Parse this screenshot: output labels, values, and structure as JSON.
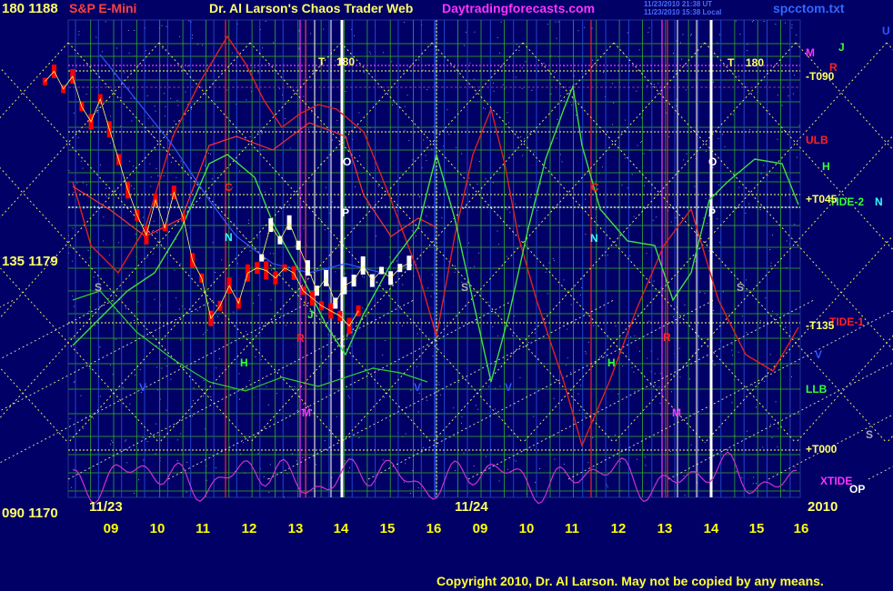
{
  "header": {
    "left_levels": "180  1188",
    "instrument": "S&P E-Mini",
    "title": "Dr. Al Larson's Chaos Trader Web",
    "site": "Daytradingforecasts.com",
    "stamp_line1": "11/23/2010 21:38 UT",
    "stamp_line2": "11/23/2010 15:38 Local",
    "filename": "spcctom.txt"
  },
  "y_labels": {
    "top": "180  1188",
    "mid": "135  1179",
    "bottom": "090  1170"
  },
  "date_labels": {
    "day1": "11/23",
    "day2": "11/24",
    "year": "2010"
  },
  "x_ticks": [
    "09",
    "10",
    "11",
    "12",
    "13",
    "14",
    "15",
    "16",
    "09",
    "10",
    "11",
    "12",
    "13",
    "14",
    "15",
    "16"
  ],
  "right_labels": {
    "m": "M",
    "j": "J",
    "u": "U",
    "r": "R",
    "t090": "-T090",
    "ulb": "ULB",
    "h": "H",
    "t045": "+T045",
    "tide2": "TIDE-2",
    "n": "N",
    "t135": "-T135",
    "tide1": "TIDE-1",
    "v": "V",
    "llb": "LLB",
    "s": "S",
    "t000": "+T000",
    "xtide": "XTIDE",
    "op": "OP"
  },
  "chart_markers": {
    "t180": "T",
    "n180": "180",
    "o": "O",
    "p": "P",
    "c": "C",
    "n": "N",
    "s": "S",
    "h": "H",
    "r": "R",
    "m": "M",
    "v": "V",
    "j": "J"
  },
  "copyright": "Copyright 2010, Dr. Al Larson. May not be copied by any means.",
  "chart_data": {
    "type": "line",
    "title": "Dr. Al Larson's Chaos Trader Web",
    "instrument": "S&P E-Mini",
    "x_axis": {
      "days": [
        "11/23",
        "11/24"
      ],
      "hours": [
        9,
        10,
        11,
        12,
        13,
        14,
        15,
        16
      ]
    },
    "y_axis": {
      "degrees": [
        90,
        135,
        180
      ],
      "price": [
        1170,
        1179,
        1188
      ],
      "range": [
        1170,
        1188
      ]
    },
    "series": [
      {
        "name": "S&P E-Mini price 11/23 (red bars)",
        "color": "#ff0000",
        "x": [
          8.1,
          8.3,
          8.5,
          8.7,
          8.9,
          9.1,
          9.3,
          9.5,
          9.7,
          9.9,
          10.1,
          10.3,
          10.5,
          10.7,
          10.9,
          11.1,
          11.3,
          11.5,
          11.7,
          11.9,
          12.1,
          12.3,
          12.5,
          12.7,
          12.9,
          13.1,
          13.3,
          13.5,
          13.7,
          13.9,
          14.1,
          14.3,
          14.5,
          14.7,
          14.9
        ],
        "y": [
          1186.5,
          1186.9,
          1186.2,
          1186.7,
          1185.5,
          1184.9,
          1185.8,
          1184.6,
          1183.4,
          1182.2,
          1181.2,
          1180.4,
          1181.8,
          1180.7,
          1182.1,
          1181.1,
          1179.4,
          1178.7,
          1177.1,
          1177.6,
          1178.4,
          1177.7,
          1178.9,
          1179.1,
          1179.0,
          1178.7,
          1179.1,
          1178.9,
          1178.2,
          1177.9,
          1177.6,
          1177.4,
          1177.2,
          1176.8,
          1177.4
        ]
      },
      {
        "name": "S&P E-Mini price 11/23 (white bars)",
        "color": "#ffffff",
        "x": [
          12.8,
          13.0,
          13.2,
          13.4,
          13.6,
          13.8,
          14.0,
          14.2,
          14.4,
          14.6,
          14.8,
          15.0,
          15.2,
          15.4,
          15.6,
          15.8,
          16.0
        ],
        "y": [
          1179.5,
          1180.8,
          1180.2,
          1180.9,
          1180.0,
          1179.1,
          1178.2,
          1178.7,
          1177.7,
          1178.4,
          1178.6,
          1179.2,
          1178.6,
          1179.0,
          1178.7,
          1179.1,
          1179.3
        ]
      },
      {
        "name": "TIDE-1",
        "color": "#ff2222"
      },
      {
        "name": "TIDE-2",
        "color": "#22ff22"
      },
      {
        "name": "XTIDE",
        "color": "#ff33ff"
      },
      {
        "name": "ULB",
        "color": "#ff0000"
      },
      {
        "name": "LLB",
        "color": "#00ff00"
      }
    ]
  }
}
